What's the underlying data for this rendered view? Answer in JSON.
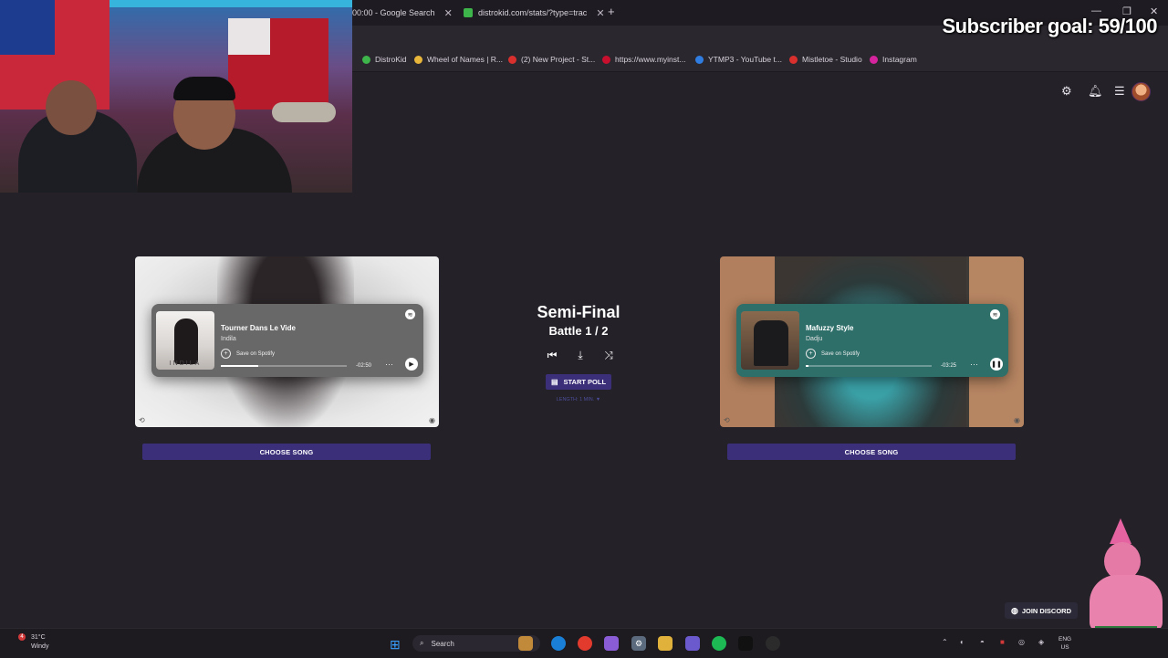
{
  "browser": {
    "tabs": [
      {
        "label": "00:00 - Google Search"
      },
      {
        "label": "distrokid.com/stats/?type=trac"
      }
    ],
    "new_tab": "+",
    "bookmarks": [
      {
        "label": "DistroKid",
        "color": "#3db54a"
      },
      {
        "label": "Wheel of Names | R...",
        "color": "#e8b63a"
      },
      {
        "label": "(2) New Project - St...",
        "color": "#d9302e"
      },
      {
        "label": "https://www.myinst...",
        "color": "#c8102e"
      },
      {
        "label": "YTMP3 - YouTube t...",
        "color": "#2f7de1"
      },
      {
        "label": "Mistletoe - Studio",
        "color": "#d9302e"
      },
      {
        "label": "Instagram",
        "color": "#d6249f"
      }
    ]
  },
  "overlay": {
    "subscriber_goal": "Subscriber goal: 59/100"
  },
  "left_song": {
    "title": "Tourner Dans Le Vide",
    "artist": "Indila",
    "save_label": "Save on Spotify",
    "time": "-02:50",
    "progress": 0.3,
    "art_text": "INDILA",
    "choose_label": "CHOOSE SONG"
  },
  "right_song": {
    "title": "Mafuzzy Style",
    "artist": "Dadju",
    "save_label": "Save on Spotify",
    "time": "-03:25",
    "progress": 0.02,
    "choose_label": "CHOOSE SONG"
  },
  "center": {
    "stage": "Semi-Final",
    "battle": "Battle 1 / 2",
    "poll_label": "START POLL",
    "length": "LENGTH: 1 MIN. ▼"
  },
  "discord": {
    "label": "JOIN DISCORD"
  },
  "taskbar": {
    "temp": "31°C",
    "condition": "Windy",
    "notif_count": "4",
    "search_placeholder": "Search",
    "lang_top": "ENG",
    "lang_bottom": "US"
  },
  "colors": {
    "accent": "#3b2f7a",
    "background": "#242128"
  }
}
